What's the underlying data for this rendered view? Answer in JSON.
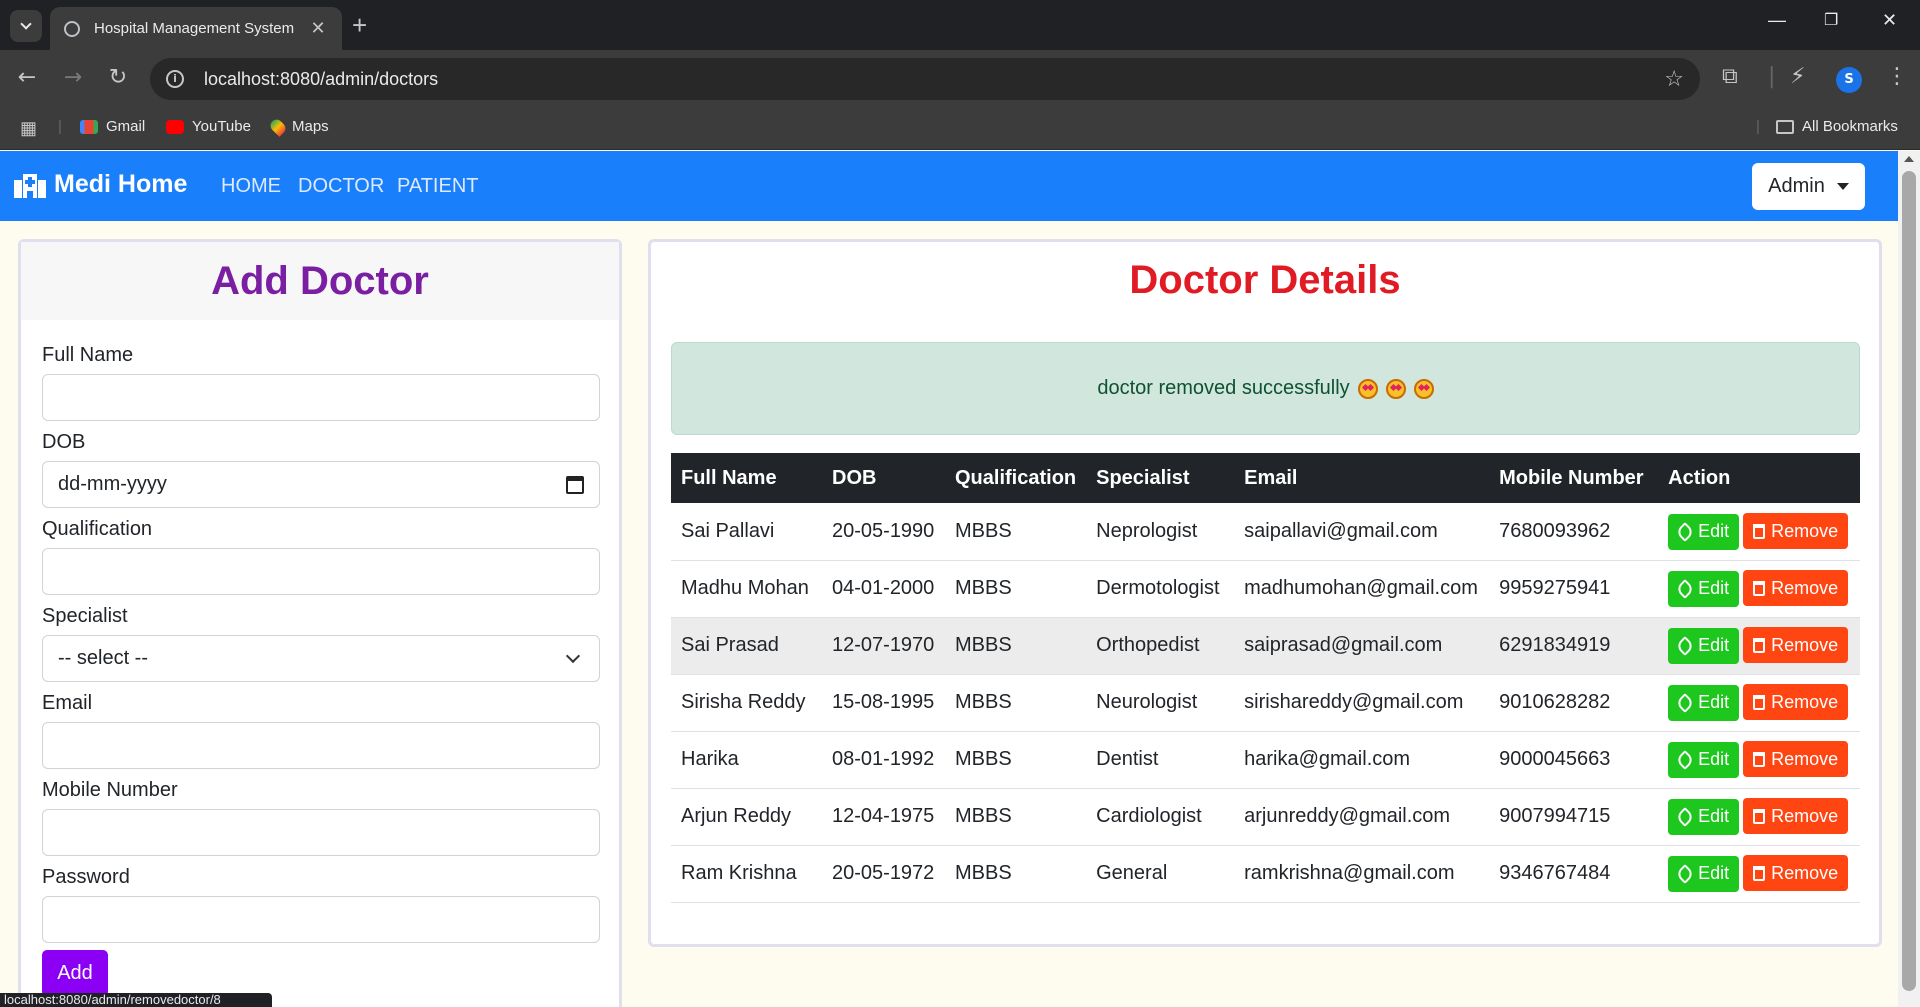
{
  "browser": {
    "tab_title": "Hospital Management System",
    "url": "localhost:8080/admin/doctors",
    "bookmarks": [
      {
        "label": "Gmail",
        "icon": "gmail-icon"
      },
      {
        "label": "YouTube",
        "icon": "youtube-icon"
      },
      {
        "label": "Maps",
        "icon": "maps-icon"
      }
    ],
    "all_bookmarks": "All Bookmarks",
    "profile_initial": "S",
    "status_url": "localhost:8080/admin/removedoctor/8"
  },
  "navbar": {
    "brand": "Medi Home",
    "links": [
      "HOME",
      "DOCTOR",
      "PATIENT"
    ],
    "user_menu": "Admin"
  },
  "add_doctor": {
    "title": "Add Doctor",
    "fields": {
      "full_name": {
        "label": "Full Name",
        "value": ""
      },
      "dob": {
        "label": "DOB",
        "placeholder": "dd-mm-yyyy"
      },
      "qualification": {
        "label": "Qualification",
        "value": ""
      },
      "specialist": {
        "label": "Specialist",
        "selected": "-- select --"
      },
      "email": {
        "label": "Email",
        "value": ""
      },
      "mobile": {
        "label": "Mobile Number",
        "value": ""
      },
      "password": {
        "label": "Password",
        "value": ""
      }
    },
    "submit_label": "Add"
  },
  "doctor_details": {
    "title": "Doctor Details",
    "alert": "doctor removed successfully",
    "columns": [
      "Full Name",
      "DOB",
      "Qualification",
      "Specialist",
      "Email",
      "Mobile Number",
      "Action"
    ],
    "edit_label": "Edit",
    "remove_label": "Remove",
    "rows": [
      {
        "name": "Sai Pallavi",
        "dob": "20-05-1990",
        "qualification": "MBBS",
        "specialist": "Neprologist",
        "email": "saipallavi@gmail.com",
        "mobile": "7680093962"
      },
      {
        "name": "Madhu Mohan",
        "dob": "04-01-2000",
        "qualification": "MBBS",
        "specialist": "Dermotologist",
        "email": "madhumohan@gmail.com",
        "mobile": "9959275941"
      },
      {
        "name": "Sai Prasad",
        "dob": "12-07-1970",
        "qualification": "MBBS",
        "specialist": "Orthopedist",
        "email": "saiprasad@gmail.com",
        "mobile": "6291834919"
      },
      {
        "name": "Sirisha Reddy",
        "dob": "15-08-1995",
        "qualification": "MBBS",
        "specialist": "Neurologist",
        "email": "sirishareddy@gmail.com",
        "mobile": "9010628282"
      },
      {
        "name": "Harika",
        "dob": "08-01-1992",
        "qualification": "MBBS",
        "specialist": "Dentist",
        "email": "harika@gmail.com",
        "mobile": "9000045663"
      },
      {
        "name": "Arjun Reddy",
        "dob": "12-04-1975",
        "qualification": "MBBS",
        "specialist": "Cardiologist",
        "email": "arjunreddy@gmail.com",
        "mobile": "9007994715"
      },
      {
        "name": "Ram Krishna",
        "dob": "20-05-1972",
        "qualification": "MBBS",
        "specialist": "General",
        "email": "ramkrishna@gmail.com",
        "mobile": "9346767484"
      }
    ]
  },
  "colors": {
    "navbar": "#1a7ffb",
    "add_title": "#7a1fa2",
    "details_title": "#e01b24",
    "edit_button": "#1ec71e",
    "remove_button": "#ff4512",
    "add_button": "#8b00f5"
  }
}
